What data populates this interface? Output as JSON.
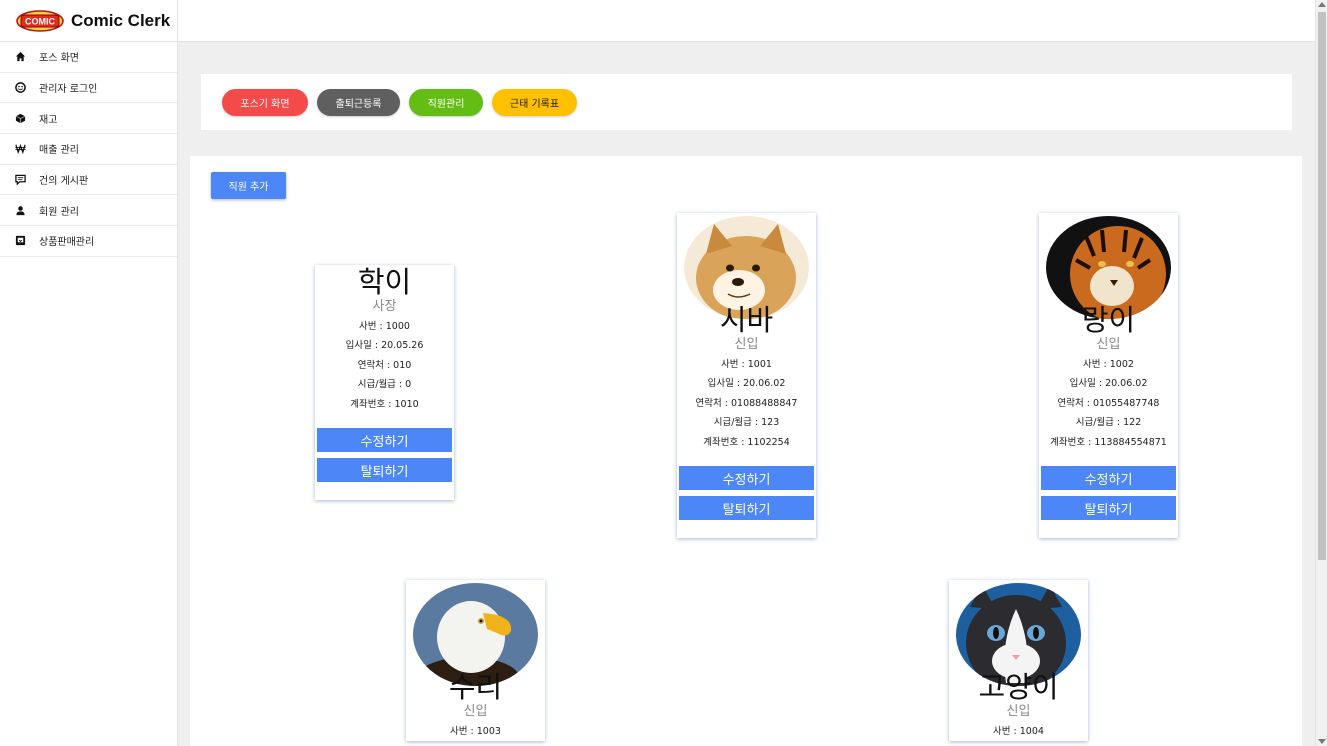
{
  "brand": {
    "title": "Comic Clerk",
    "logo_text": "COMIC"
  },
  "sidebar": {
    "items": [
      {
        "label": "포스 화면",
        "icon": "home-icon"
      },
      {
        "label": "관리자 로그인",
        "icon": "smile-icon"
      },
      {
        "label": "재고",
        "icon": "box-icon"
      },
      {
        "label": "매출 관리",
        "icon": "won-icon"
      },
      {
        "label": "건의 게시판",
        "icon": "chat-icon"
      },
      {
        "label": "회원 관리",
        "icon": "user-icon"
      },
      {
        "label": "상품판매관리",
        "icon": "sale-icon"
      }
    ]
  },
  "toolbar": {
    "pos_label": "포스기 화면",
    "attendance_label": "출퇴근등록",
    "staff_label": "직원관리",
    "timesheet_label": "근태 기록표",
    "colors": {
      "red": "#f44a4a",
      "gray": "#5f5f5f",
      "green": "#63bd14",
      "yellow": "#ffc000"
    }
  },
  "staff": {
    "add_label": "직원 추가",
    "edit_label": "수정하기",
    "quit_label": "탈퇴하기",
    "accent": "#4c86f7",
    "employees": [
      {
        "name": "학이",
        "rank": "사장",
        "id": "사번 : 1000",
        "joined": "입사일 : 20.05.26",
        "phone": "연락처 : 010",
        "wage": "시급/월급 : 0",
        "account": "계좌번호 : 1010"
      },
      {
        "name": "시바",
        "rank": "신입",
        "photo": "shiba-dog-photo",
        "id": "사번 : 1001",
        "joined": "입사일 : 20.06.02",
        "phone": "연락처 : 01088488847",
        "wage": "시급/월급 : 123",
        "account": "계좌번호 : 1102254"
      },
      {
        "name": "랑이",
        "rank": "신입",
        "photo": "tiger-photo",
        "id": "사번 : 1002",
        "joined": "입사일 : 20.06.02",
        "phone": "연락처 : 01055487748",
        "wage": "시급/월급 : 122",
        "account": "계좌번호 : 113884554871"
      },
      {
        "name": "수리",
        "rank": "신입",
        "photo": "eagle-photo",
        "id": "사번 : 1003"
      },
      {
        "name": "고양이",
        "rank": "신입",
        "photo": "cat-photo",
        "id": "사번 : 1004"
      }
    ]
  }
}
